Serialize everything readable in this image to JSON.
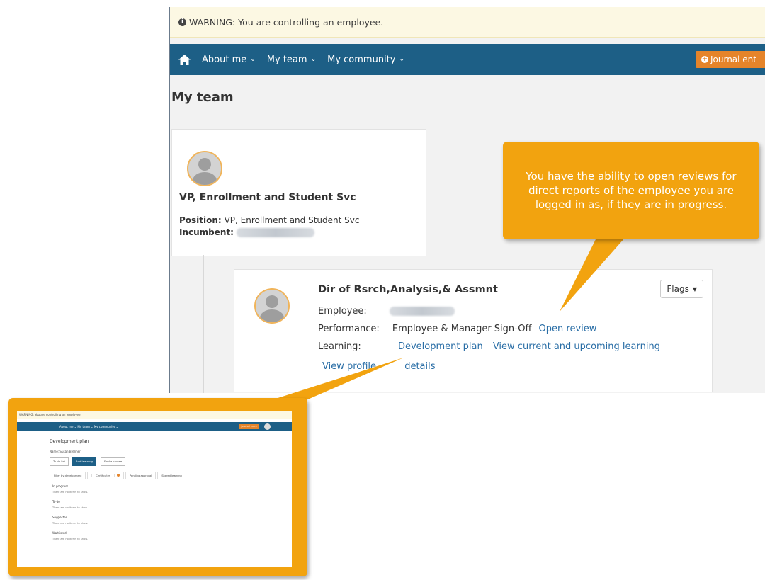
{
  "warning": {
    "icon": "info-circle-icon",
    "text": "WARNING: You are controlling an employee."
  },
  "nav": {
    "home_icon": "home-icon",
    "items": [
      "About me",
      "My team",
      "My community"
    ],
    "journal_label": "Journal ent"
  },
  "page_title": "My team",
  "manager_card": {
    "title": "VP, Enrollment and Student Svc",
    "position_label": "Position:",
    "position_value": "VP, Enrollment and Student Svc",
    "incumbent_label": "Incumbent:"
  },
  "employee_card": {
    "title": "Dir of Rsrch,Analysis,& Assmnt",
    "flags_label": "Flags",
    "employee_label": "Employee:",
    "performance_label": "Performance:",
    "performance_status": "Employee & Manager Sign-Off",
    "open_review": "Open review",
    "learning_label": "Learning:",
    "development_plan": "Development plan",
    "view_learning": "View current and upcoming learning",
    "view_profile": "View profile",
    "view_details": "details"
  },
  "callout_text": "You have the ability to open reviews for direct reports of the employee you are logged in as, if they are in progress.",
  "inset": {
    "warning": "WARNING: You are controlling an employee.",
    "nav": "About me ⌄   My team ⌄   My community ⌄",
    "journal": "Journal entry",
    "title": "Development plan",
    "subtitle": "Name: Susan Brenner",
    "buttons": [
      "To-do list",
      "Add learning",
      "Find a course"
    ],
    "tabs": [
      "Filter by development",
      "Certificates",
      "Pending approval",
      "Shared learning"
    ],
    "sections": [
      {
        "heading": "In progress",
        "empty": "There are no items to show."
      },
      {
        "heading": "To-do",
        "empty": "There are no items to show."
      },
      {
        "heading": "Suggested",
        "empty": "There are no items to show."
      },
      {
        "heading": "Waitlisted",
        "empty": "There are no items to show."
      }
    ]
  },
  "colors": {
    "navbar": "#1d5f86",
    "accent": "#e5842a",
    "callout": "#f2a30f",
    "link": "#2a6ea6"
  }
}
